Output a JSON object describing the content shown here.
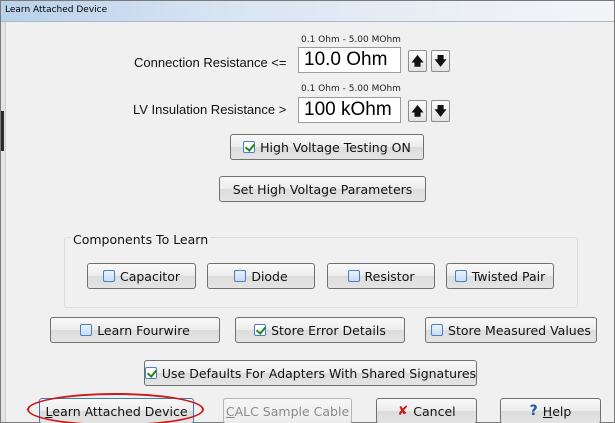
{
  "window": {
    "title": "Learn Attached Device"
  },
  "connection": {
    "label": "Connection Resistance <=",
    "range": "0.1 Ohm - 5.00 MOhm",
    "value": "10.0 Ohm",
    "up": "🡅",
    "down": "🡇"
  },
  "insulation": {
    "label": "LV Insulation Resistance >",
    "range": "0.1 Ohm - 5.00 MOhm",
    "value": "100 kOhm",
    "up": "🡅",
    "down": "🡇"
  },
  "hv_testing": {
    "label": "High Voltage Testing ON",
    "checked": true
  },
  "hv_params": {
    "label": "Set High Voltage Parameters"
  },
  "components": {
    "title": "Components To Learn",
    "items": [
      {
        "label": "Capacitor",
        "checked": false
      },
      {
        "label": "Diode",
        "checked": false
      },
      {
        "label": "Resistor",
        "checked": false
      },
      {
        "label": "Twisted Pair",
        "checked": false
      }
    ]
  },
  "options": {
    "learn_fourwire": {
      "label": "Learn Fourwire",
      "checked": false
    },
    "store_errors": {
      "label": "Store Error Details",
      "checked": true
    },
    "store_measured": {
      "label": "Store Measured Values",
      "checked": false
    },
    "use_defaults": {
      "label": "Use Defaults For Adapters With Shared Signatures",
      "checked": true
    }
  },
  "footer": {
    "learn_label_first": "L",
    "learn_label_rest": "earn Attached Device",
    "calc_label_first": "C",
    "calc_label_rest": "ALC Sample Cable",
    "cancel_label": "Cancel",
    "help_label_first": "H",
    "help_label_rest": "elp",
    "cancel_icon": "✘",
    "help_icon": "?"
  },
  "colors": {
    "highlight_ellipse": "#c81b1b",
    "check_green": "#1d8a1d",
    "cancel_red": "#c8201c",
    "help_blue": "#1a56b0"
  }
}
